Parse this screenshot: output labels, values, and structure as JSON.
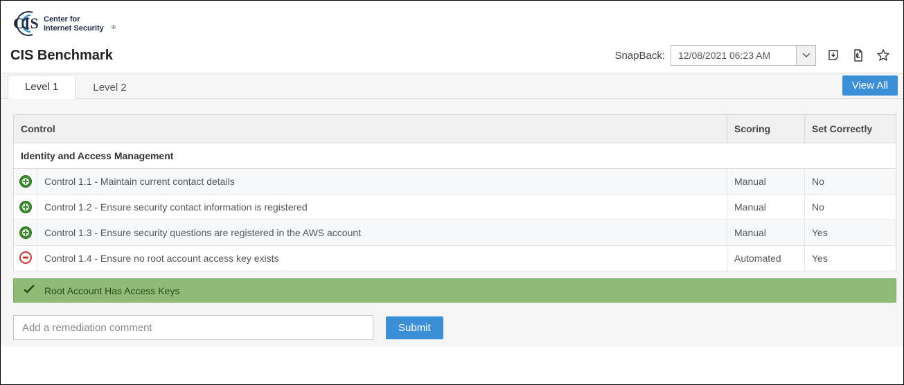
{
  "logo": {
    "main": "CIS",
    "sub1": "Center for",
    "sub2": "Internet Security",
    "reg": "®"
  },
  "page_title": "CIS Benchmark",
  "snapback": {
    "label": "SnapBack:",
    "value": "12/08/2021 06:23 AM"
  },
  "toolbar_icons": [
    "download-icon",
    "pdf-icon",
    "star-icon"
  ],
  "tabs": [
    {
      "label": "Level 1",
      "active": true
    },
    {
      "label": "Level 2",
      "active": false
    }
  ],
  "view_all_label": "View All",
  "columns": {
    "control": "Control",
    "scoring": "Scoring",
    "set": "Set Correctly"
  },
  "section_heading": "Identity and Access Management",
  "rows": [
    {
      "icon": "plus",
      "control": "Control 1.1 - Maintain current contact details",
      "scoring": "Manual",
      "set": "No"
    },
    {
      "icon": "plus",
      "control": "Control 1.2 - Ensure security contact information is registered",
      "scoring": "Manual",
      "set": "No"
    },
    {
      "icon": "plus",
      "control": "Control 1.3 - Ensure security questions are registered in the AWS account",
      "scoring": "Manual",
      "set": "Yes"
    },
    {
      "icon": "minus",
      "control": "Control 1.4 - Ensure no root account access key exists",
      "scoring": "Automated",
      "set": "Yes"
    }
  ],
  "status_message": "Root Account Has Access Keys",
  "remediation": {
    "placeholder": "Add a remediation comment",
    "submit": "Submit"
  }
}
